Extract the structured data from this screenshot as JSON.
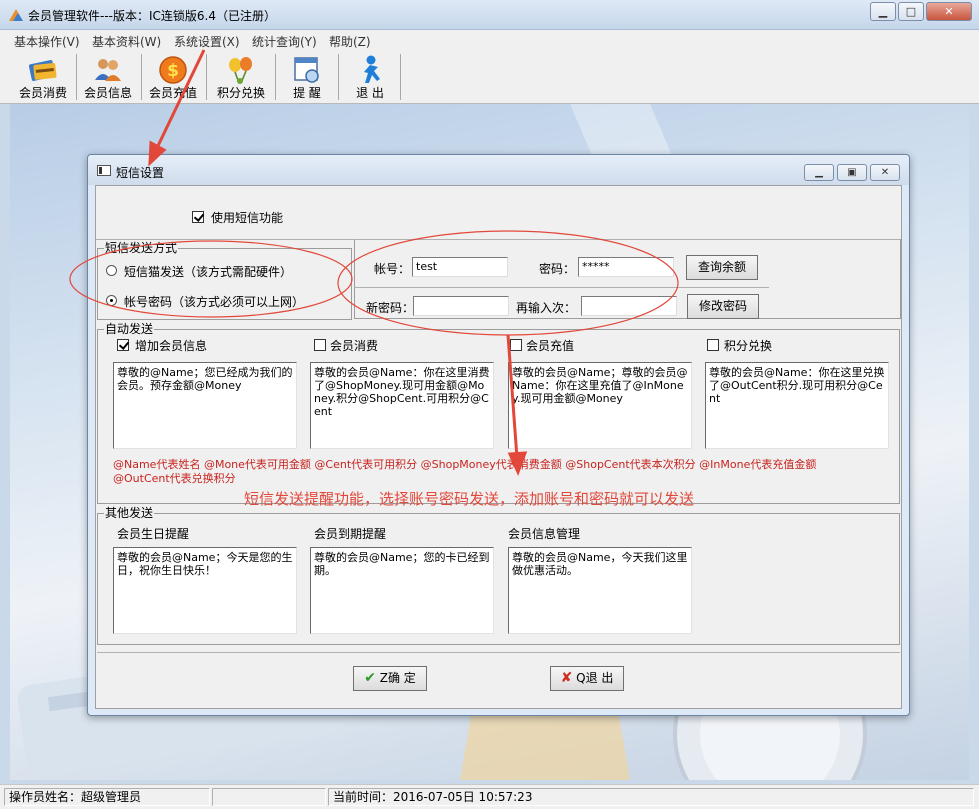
{
  "window": {
    "title": "会员管理软件---版本：IC连锁版6.4（已注册）"
  },
  "menu": [
    "基本操作(V)",
    "基本资料(W)",
    "系统设置(X)",
    "统计查询(Y)",
    "帮助(Z)"
  ],
  "toolbar": [
    "会员消费",
    "会员信息",
    "会员充值",
    "积分兑换",
    "提 醒",
    "退 出"
  ],
  "status": {
    "operator": "操作员姓名：超级管理员",
    "time": "当前时间：2016-07-05日 10:57:23"
  },
  "dialog": {
    "title": "短信设置",
    "enable_sms": "使用短信功能",
    "send_mode": {
      "caption": "短信发送方式",
      "option1": "短信猫发送（该方式需配硬件）",
      "option2": "帐号密码（该方式必须可以上网）"
    },
    "account": {
      "account_label": "帐号：",
      "account_value": "test",
      "password_label": "密码：",
      "password_value": "*****",
      "query_button": "查询余额",
      "new_password_label": "新密码：",
      "new_password_value": "",
      "repeat_label": "再输入次：",
      "repeat_value": "",
      "change_button": "修改密码"
    },
    "auto_send": {
      "caption": "自动发送",
      "items": [
        {
          "label": "增加会员信息",
          "checked": true,
          "template": "尊敬的@Name；您已经成为我们的会员。预存金额@Money"
        },
        {
          "label": "会员消费",
          "checked": false,
          "template": "尊敬的会员@Name：你在这里消费了@ShopMoney.现可用金额@Money.积分@ShopCent.可用积分@Cent"
        },
        {
          "label": "会员充值",
          "checked": false,
          "template": "尊敬的会员@Name；尊敬的会员@Name：你在这里充值了@InMoney.现可用金额@Money"
        },
        {
          "label": "积分兑换",
          "checked": false,
          "template": "尊敬的会员@Name：你在这里兑换了@OutCent积分.现可用积分@Cent"
        }
      ],
      "hint_line1": "@Name代表姓名 @Mone代表可用金额 @Cent代表可用积分 @ShopMoney代表消费金额 @ShopCent代表本次积分 @InMone代表充值金额",
      "hint_line2": "@OutCent代表兑换积分"
    },
    "other_send": {
      "caption": "其他发送",
      "items": [
        {
          "label": "会员生日提醒",
          "template": "尊敬的会员@Name；今天是您的生日，祝你生日快乐！"
        },
        {
          "label": "会员到期提醒",
          "template": "尊敬的会员@Name；您的卡已经到期。"
        },
        {
          "label": "会员信息管理",
          "template": "尊敬的会员@Name，今天我们这里做优惠活动。"
        }
      ]
    },
    "ok_button": "Z确 定",
    "cancel_button": "Q退 出"
  },
  "annotation": "短信发送提醒功能，选择账号密码发送，添加账号和密码就可以发送",
  "colors": {
    "annotation": "#e2483a",
    "hint": "#c8231e",
    "titlebar": "#cfdcec",
    "close": "#c8553e"
  }
}
